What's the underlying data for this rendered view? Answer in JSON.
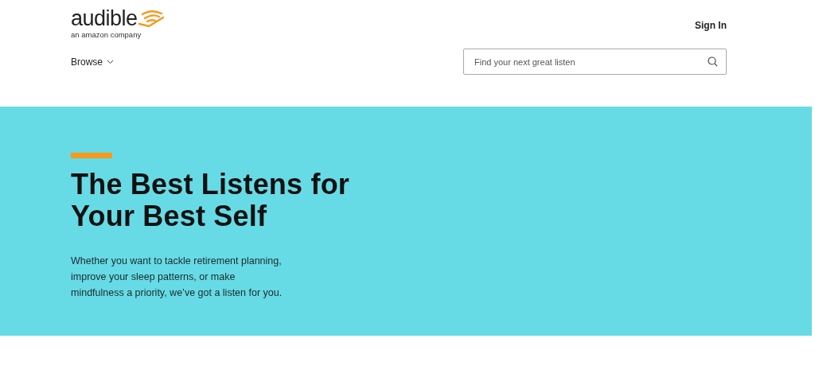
{
  "header": {
    "logo": {
      "wordmark": "audible",
      "tagline": "an amazon company"
    },
    "sign_in": "Sign In",
    "browse": "Browse",
    "search": {
      "placeholder": "Find your next great listen"
    }
  },
  "hero": {
    "title_lines": [
      "The Best Listens for",
      "Your Best Self"
    ],
    "body_lines": [
      "Whether you want to tackle retirement planning,",
      "improve your sleep patterns, or make",
      "mindfulness a priority, we’ve got a listen for you."
    ]
  }
}
